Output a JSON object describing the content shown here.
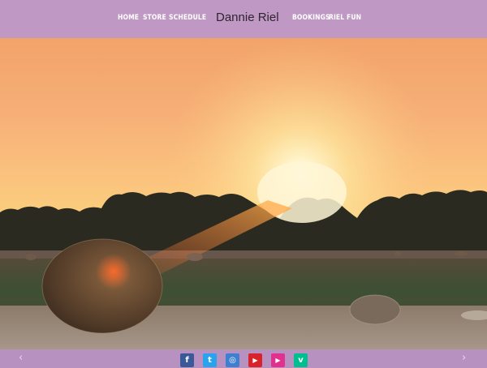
{
  "header": {
    "brand": "Dannie Riel",
    "nav_left": [
      "HOME",
      "STORE",
      "SCHEDULE"
    ],
    "nav_right": [
      "BOOKINGS",
      "RIEL FUN"
    ]
  },
  "hero": {
    "image": "sunset-hay-bales-field"
  },
  "footer": {
    "prev_arrow": "‹",
    "next_arrow": "›",
    "social": [
      {
        "icon": "facebook-icon",
        "glyph": "f",
        "color": "#3b5998"
      },
      {
        "icon": "twitter-icon",
        "glyph": "t",
        "color": "#2aa3ef"
      },
      {
        "icon": "instagram-icon",
        "glyph": "◎",
        "color": "#3f7fcf"
      },
      {
        "icon": "youtube-icon",
        "glyph": "▶",
        "color": "#d8232a"
      },
      {
        "icon": "youtube-alt-icon",
        "glyph": "▶",
        "color": "#e0318f"
      },
      {
        "icon": "vine-icon",
        "glyph": "v",
        "color": "#00bf8f"
      }
    ]
  },
  "colors": {
    "topbar": "#bf98c3",
    "footer": "#b791bf",
    "brand_text": "#2f2533"
  }
}
